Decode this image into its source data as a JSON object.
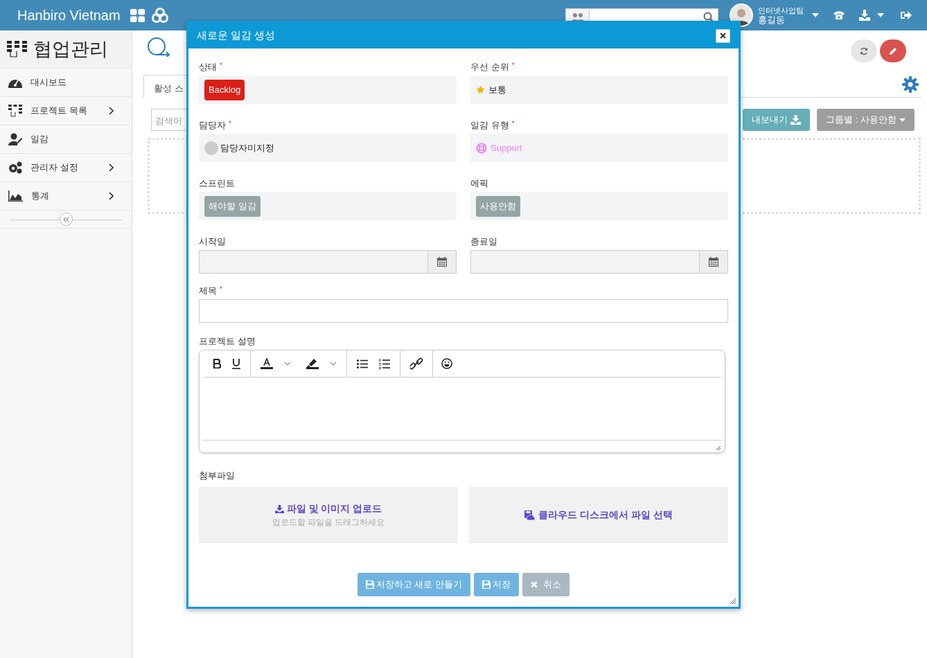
{
  "header": {
    "brand": "Hanbiro Vietnam",
    "user": {
      "team": "인터넷사업팀",
      "name": "홍길동"
    }
  },
  "sidebar": {
    "title": "협업관리",
    "items": [
      {
        "label": "대시보드",
        "kind": "dashboard",
        "has_submenu": false
      },
      {
        "label": "프로젝트 목록",
        "kind": "projects",
        "has_submenu": true
      },
      {
        "label": "일감",
        "kind": "tasks",
        "has_submenu": false
      },
      {
        "label": "관리자 설정",
        "kind": "settings",
        "has_submenu": true
      },
      {
        "label": "통계",
        "kind": "stats",
        "has_submenu": true
      }
    ]
  },
  "content": {
    "tab": "활성 스",
    "search_placeholder": "검색어",
    "buttons": [
      {
        "label": "내보내기",
        "kind": "export"
      },
      {
        "label": "그룹별 : 사용안함",
        "kind": "group"
      }
    ]
  },
  "dialog": {
    "title": "새로운 일감 생성",
    "fields": [
      {
        "kind": "status",
        "label": "상태",
        "required_mark": "*",
        "value": "Backlog",
        "color": "#dc1f18"
      },
      {
        "kind": "priority",
        "label": "우선 순위",
        "required_mark": "*",
        "value": "보통"
      },
      {
        "kind": "assignee",
        "label": "담당자",
        "required_mark": "*",
        "value": "담당자미지정"
      },
      {
        "kind": "type",
        "label": "일감 유형",
        "required_mark": "*",
        "value": "Support"
      },
      {
        "kind": "tag",
        "label": "스프린트",
        "value": "해야할 일감"
      },
      {
        "kind": "tag",
        "label": "에픽",
        "value": "사용안함"
      },
      {
        "kind": "date",
        "label": "시작일"
      },
      {
        "kind": "date",
        "label": "종료일"
      },
      {
        "kind": "text",
        "label": "제목",
        "required_mark": "*"
      },
      {
        "kind": "editor",
        "label": "프로젝트 설명"
      }
    ],
    "attachments": {
      "label": "첨부파일",
      "upload_title": "파일 및 이미지 업로드",
      "upload_hint": "업로드할 파일을 드래그하세요",
      "cloud_title": "클라우드 디스크에서 파일 선택"
    },
    "buttons": [
      {
        "label": "저장하고 새로 만들기",
        "kind": "save_new"
      },
      {
        "label": "저장",
        "kind": "save"
      },
      {
        "label": "취소",
        "kind": "cancel"
      }
    ]
  }
}
